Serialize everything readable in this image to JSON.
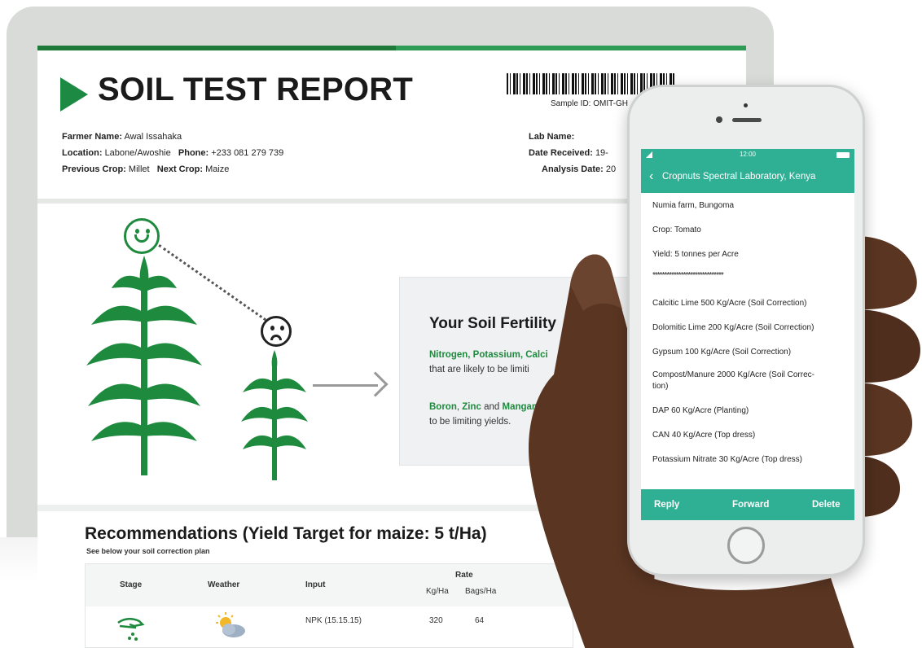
{
  "report": {
    "title": "SOIL TEST REPORT",
    "sample_id": "Sample ID: OMIT-GH",
    "farmer_name_label": "Farmer Name:",
    "farmer_name": "Awal Issahaka",
    "location_label": "Location:",
    "location": "Labone/Awoshie",
    "phone_label": "Phone:",
    "phone": "+233 081 279 739",
    "previous_crop_label": "Previous Crop:",
    "previous_crop": "Millet",
    "next_crop_label": "Next Crop:",
    "next_crop": "Maize",
    "lab_name_label": "Lab Name:",
    "lab_name": "",
    "date_received_label": "Date Received:",
    "date_received": "19-",
    "analysis_date_label": "Analysis Date:",
    "analysis_date": "20"
  },
  "fertility": {
    "heading": "Your Soil Fertility",
    "p1_nutrients": "Nitrogen, Potassium, Calci",
    "p1_text": "that are likely to be limiti",
    "p2_boron": "Boron",
    "p2_sep1": ",",
    "p2_zinc": "Zinc",
    "p2_and": "and",
    "p2_mang": "Mangan",
    "p2_text": "to be limiting yields."
  },
  "recommendations": {
    "title": "Recommendations (Yield Target for maize: 5 t/Ha)",
    "subtitle": "See below your soil correction plan",
    "columns": {
      "stage": "Stage",
      "weather": "Weather",
      "input": "Input",
      "rate": "Rate",
      "kg_ha": "Kg/Ha",
      "bags_ha": "Bags/Ha"
    },
    "rows": [
      {
        "input": "NPK (15.15.15)",
        "kg_ha": "320",
        "bags_ha": "64"
      }
    ]
  },
  "phone": {
    "time": "12:00",
    "header_title": "Cropnuts Spectral Laboratory, Kenya",
    "messages": [
      "Numia farm, Bungoma",
      "Crop: Tomato",
      "Yield: 5 tonnes per Acre",
      "******************************",
      "Calcitic Lime 500 Kg/Acre (Soil Correction)",
      "Dolomitic Lime 200 Kg/Acre (Soil Correction)",
      "Gypsum 100 Kg/Acre (Soil Correction)",
      "Compost/Manure 2000 Kg/Acre (Soil Correc-",
      "tion)",
      "DAP 60 Kg/Acre (Planting)",
      "CAN 40 Kg/Acre (Top dress)",
      "Potassium Nitrate 30 Kg/Acre (Top dress)"
    ],
    "buttons": {
      "reply": "Reply",
      "forward": "Forward",
      "delete": "Delete"
    }
  },
  "colors": {
    "brand_green": "#1e8a3e",
    "phone_teal": "#2fb094",
    "skin": "#5a3522"
  }
}
